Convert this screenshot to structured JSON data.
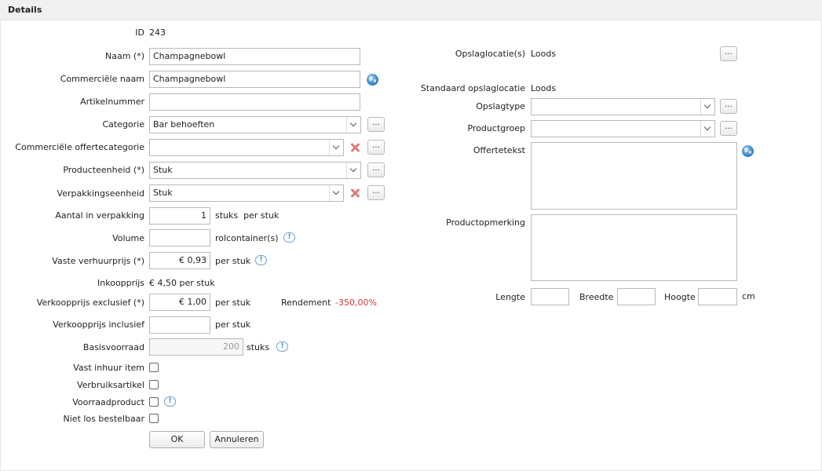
{
  "header": {
    "title": "Details"
  },
  "left": {
    "id": {
      "label": "ID",
      "value": "243"
    },
    "naam": {
      "label": "Naam (*)",
      "value": "Champagnebowl"
    },
    "commerciele_naam": {
      "label": "Commerciële naam",
      "value": "Champagnebowl"
    },
    "artikelnummer": {
      "label": "Artikelnummer",
      "value": ""
    },
    "categorie": {
      "label": "Categorie",
      "value": "Bar behoeften"
    },
    "offertecategorie": {
      "label": "Commerciële offertecategorie",
      "value": ""
    },
    "producteenheid": {
      "label": "Producteenheid (*)",
      "value": "Stuk"
    },
    "verpakkingseenheid": {
      "label": "Verpakkingseenheid",
      "value": "Stuk"
    },
    "aantal_verpakking": {
      "label": "Aantal in verpakking",
      "value": "1",
      "suffix": "stuks  per stuk"
    },
    "volume": {
      "label": "Volume",
      "value": "",
      "suffix": "rolcontainer(s)"
    },
    "vaste_verhuurprijs": {
      "label": "Vaste verhuurprijs (*)",
      "value": "€ 0,93",
      "suffix": "per stuk"
    },
    "inkoopprijs": {
      "label": "Inkoopprijs",
      "value": "€ 4,50 per stuk"
    },
    "verkoopprijs_excl": {
      "label": "Verkoopprijs exclusief (*)",
      "value": "€ 1,00",
      "suffix": "per stuk"
    },
    "rendement": {
      "label": "Rendement",
      "value": "-350,00%"
    },
    "verkoopprijs_incl": {
      "label": "Verkoopprijs inclusief",
      "value": "",
      "suffix": "per stuk"
    },
    "basisvoorraad": {
      "label": "Basisvoorraad",
      "value": "200",
      "suffix": "stuks"
    },
    "vast_inhuur": {
      "label": "Vast inhuur item"
    },
    "verbruiksartikel": {
      "label": "Verbruiksartikel"
    },
    "voorraadproduct": {
      "label": "Voorraadproduct"
    },
    "niet_los": {
      "label": "Niet los bestelbaar"
    }
  },
  "right": {
    "opslaglocaties": {
      "label": "Opslaglocatie(s)",
      "value": "Loods"
    },
    "standaard_opslaglocatie": {
      "label": "Standaard opslaglocatie",
      "value": "Loods"
    },
    "opslagtype": {
      "label": "Opslagtype",
      "value": ""
    },
    "productgroep": {
      "label": "Productgroep",
      "value": ""
    },
    "offertetekst": {
      "label": "Offertetekst"
    },
    "productopmerking": {
      "label": "Productopmerking"
    },
    "lengte": {
      "label": "Lengte"
    },
    "breedte": {
      "label": "Breedte"
    },
    "hoogte": {
      "label": "Hoogte"
    },
    "unit": "cm"
  },
  "common": {
    "dots": "...",
    "info": "!"
  },
  "buttons": {
    "ok": "OK",
    "cancel": "Annuleren"
  },
  "colors": {
    "header_bg": "#f0f0f0",
    "negative": "#dd3333",
    "info": "#4a88c7",
    "delete": "#e07a7a"
  },
  "icons": [
    "globe-icon",
    "info-icon",
    "delete-icon",
    "chevron-down-icon"
  ]
}
